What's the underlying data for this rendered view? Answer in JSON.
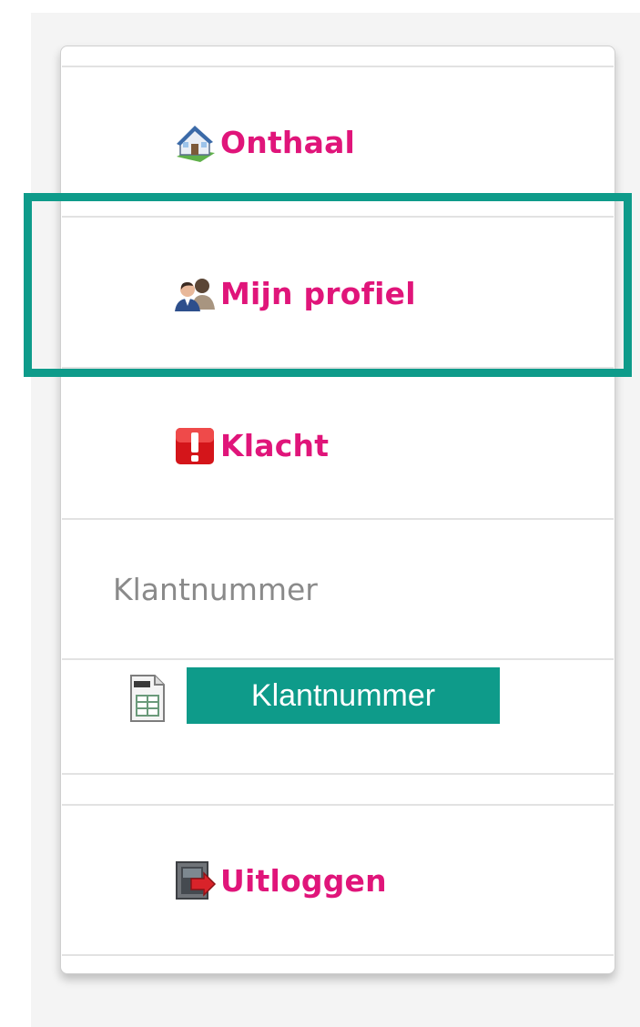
{
  "menu": {
    "items": [
      {
        "label": "Onthaal",
        "icon": "home-icon"
      },
      {
        "label": "Mijn profiel",
        "icon": "users-icon"
      },
      {
        "label": "Klacht",
        "icon": "warning-icon"
      }
    ],
    "logout": {
      "label": "Uitloggen",
      "icon": "logout-door-icon"
    }
  },
  "section": {
    "heading": "Klantnummer",
    "button_label": "Klantnummer",
    "doc_icon": "document-icon"
  },
  "colors": {
    "link": "#e0157a",
    "accent": "#0e9b8a",
    "heading": "#8a8a8a"
  }
}
